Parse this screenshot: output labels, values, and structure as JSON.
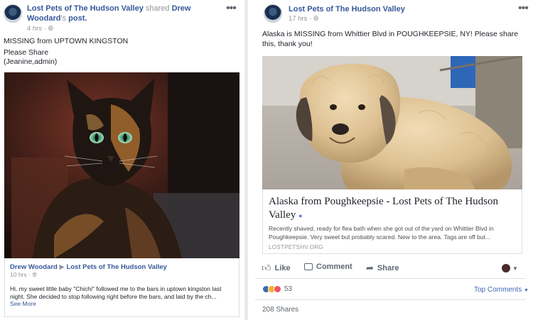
{
  "left_post": {
    "page_name": "Lost Pets of The Hudson Valley",
    "shared_text": "shared",
    "shared_user": "Drew Woodard",
    "shared_suffix": "'s",
    "shared_object": "post.",
    "timestamp": "4 hrs",
    "line1": "MISSING from UPTOWN KINGSTON",
    "line2": "Please Share",
    "line3": "(Jeanine,admin)",
    "image_icon": "tortoiseshell-cat-photo",
    "original_author": "Drew Woodard",
    "original_target": "Lost Pets of The Hudson Valley",
    "original_time": "10 hrs",
    "original_text": "Hi. my sweet little baby \"Chichi\" followed me to the bars in uptown kingston last night. She decided to stop following right before the bars, and laid by the ch...",
    "see_more": "See More"
  },
  "right_post": {
    "page_name": "Lost Pets of The Hudson Valley",
    "timestamp": "17 hrs",
    "body": "Alaska is MISSING from Whittier Blvd in POUGHKEEPSIE, NY! Please share this, thank you!",
    "image_icon": "shaggy-dog-photo",
    "link_title": "Alaska from Poughkeepsie - Lost Pets of The Hudson Valley",
    "link_desc": "Recently shaved, ready for flea bath when she got out of the yard on Whittier Blvd in Poughkeepsie. Very sweet but probably scared. New to the area. Tags are off but...",
    "link_domain": "LOSTPETSHV.ORG",
    "like": "Like",
    "comment": "Comment",
    "share": "Share",
    "reaction_count": "53",
    "top_comments": "Top Comments",
    "shares": "208 Shares"
  },
  "colors": {
    "link_blue": "#365899",
    "meta_grey": "#90949c",
    "like_blue": "#4267b2",
    "love_red": "#f25268"
  },
  "icons": [
    "globe-icon",
    "more-dots-icon",
    "like-thumb-icon",
    "comment-bubble-icon",
    "share-arrow-icon",
    "dropdown-caret-icon",
    "reaction-icons"
  ]
}
